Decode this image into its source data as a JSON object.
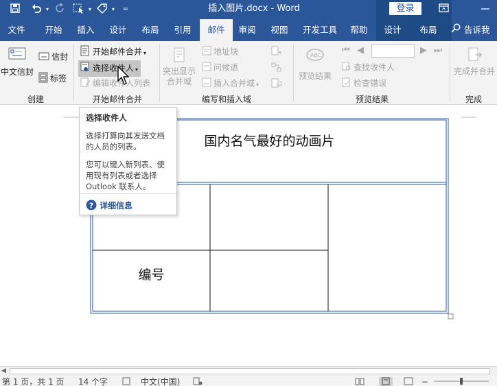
{
  "titlebar": {
    "document_title": "插入图片.docx  -  Word",
    "login_label": "登录"
  },
  "tabs": [
    {
      "label": "文件",
      "active": false
    },
    {
      "label": "开始",
      "active": false
    },
    {
      "label": "插入",
      "active": false
    },
    {
      "label": "设计",
      "active": false
    },
    {
      "label": "布局",
      "active": false
    },
    {
      "label": "引用",
      "active": false
    },
    {
      "label": "邮件",
      "active": true
    },
    {
      "label": "审阅",
      "active": false
    },
    {
      "label": "视图",
      "active": false
    },
    {
      "label": "开发工具",
      "active": false
    },
    {
      "label": "帮助",
      "active": false
    }
  ],
  "context_tabs": [
    {
      "label": "设计"
    },
    {
      "label": "布局"
    }
  ],
  "tell_me": "告诉我",
  "ribbon": {
    "create_group": {
      "label": "创建",
      "envelope_label": "中文信封",
      "envelopes_label": "信封",
      "labels_label": "标签"
    },
    "start_merge_group": {
      "label": "开始邮件合并",
      "start_merge_label": "开始邮件合并",
      "select_recipients_label": "选择收件人",
      "edit_list_label": "编辑收件人列表"
    },
    "write_insert_group": {
      "label": "编写和插入域",
      "highlight_label_1": "突出显示",
      "highlight_label_2": "合并域",
      "address_block_label": "地址块",
      "greeting_line_label": "问候语",
      "insert_field_label": "插入合并域"
    },
    "preview_group": {
      "label": "预览结果",
      "preview_label": "预览结果",
      "find_recipient_label": "查找收件人",
      "check_errors_label": "检查错误"
    },
    "finish_group": {
      "label": "完成",
      "finish_merge_label": "完成并合并"
    }
  },
  "tooltip": {
    "title": "选择收件人",
    "para1": "选择打算向其发送文档的人员的列表。",
    "para2": "您可以键入新列表、使用现有列表或者选择 Outlook 联系人。",
    "link": "详细信息"
  },
  "document": {
    "table_title": "国内名气最好的动画片",
    "cell_number": "编号"
  },
  "statusbar": {
    "page": "第 1 页，共 1 页",
    "words": "14 个字",
    "language": "中文(中国)"
  },
  "colors": {
    "accent": "#2b579a",
    "context_accent": "#1e4a85",
    "ribbon_bg": "#f3f3f3",
    "disabled_text": "#a6a6a6"
  }
}
